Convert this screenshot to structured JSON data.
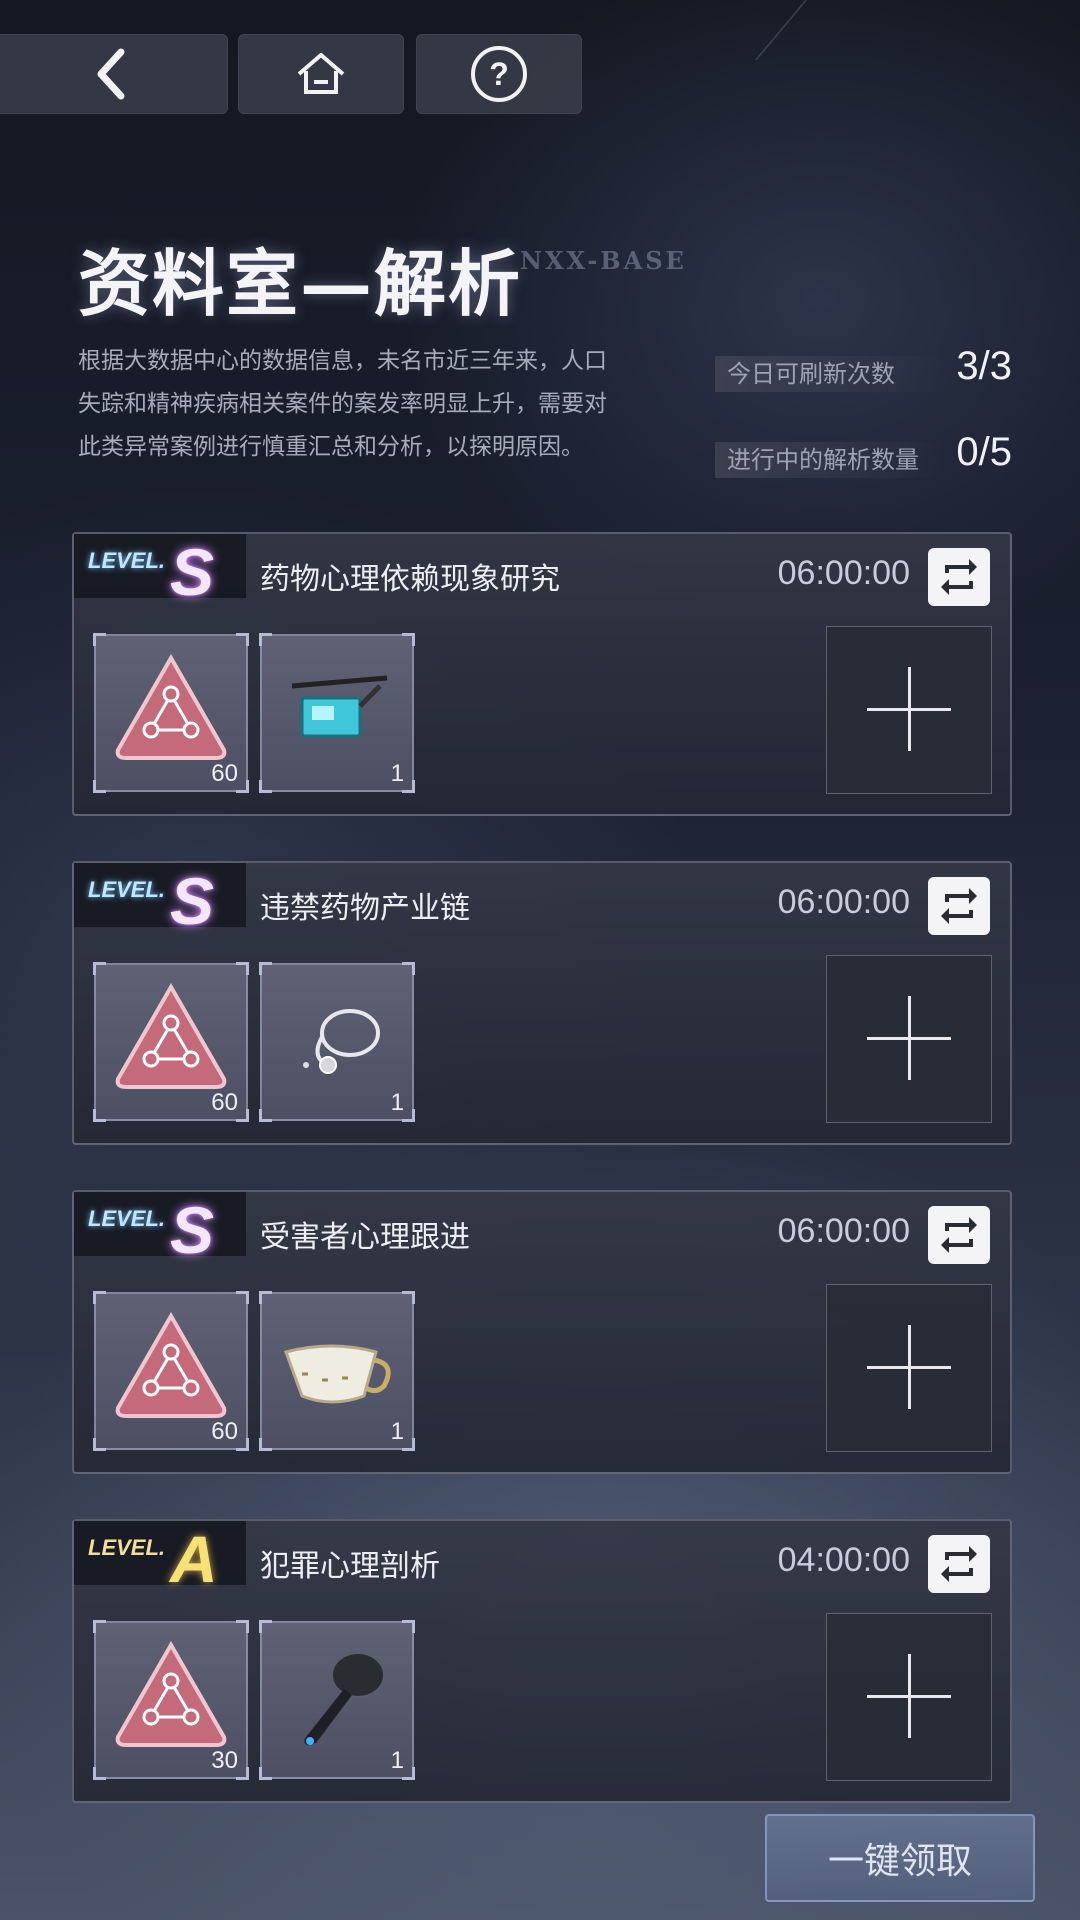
{
  "nav": {
    "back_icon": "chevron-left-icon",
    "home_icon": "home-icon",
    "help_icon": "question-circle-icon"
  },
  "header": {
    "title": "资料室—解析",
    "tag": "NXX-BASE",
    "description_lines": [
      "根据大数据中心的数据信息，未名市近三年来，人口",
      "失踪和精神疾病相关案件的案发率明显上升，需要对",
      "此类异常案例进行慎重汇总和分析，以探明原因。"
    ]
  },
  "stats": {
    "refresh_label": "今日可刷新次数",
    "refresh_value": "3/3",
    "progress_label": "进行中的解析数量",
    "progress_value": "0/5"
  },
  "tasks": [
    {
      "level_word": "LEVEL.",
      "level": "S",
      "title": "药物心理依赖现象研究",
      "time": "06:00:00",
      "items": [
        {
          "icon": "pink-triangle-emblem-icon",
          "qty": "60"
        },
        {
          "icon": "cyber-glasses-icon",
          "qty": "1"
        }
      ]
    },
    {
      "level_word": "LEVEL.",
      "level": "S",
      "title": "违禁药物产业链",
      "time": "06:00:00",
      "items": [
        {
          "icon": "pink-triangle-emblem-icon",
          "qty": "60"
        },
        {
          "icon": "stethoscope-icon",
          "qty": "1"
        }
      ]
    },
    {
      "level_word": "LEVEL.",
      "level": "S",
      "title": "受害者心理跟进",
      "time": "06:00:00",
      "items": [
        {
          "icon": "pink-triangle-emblem-icon",
          "qty": "60"
        },
        {
          "icon": "teacup-icon",
          "qty": "1"
        }
      ]
    },
    {
      "level_word": "LEVEL.",
      "level": "A",
      "title": "犯罪心理剖析",
      "time": "04:00:00",
      "items": [
        {
          "icon": "pink-triangle-emblem-icon",
          "qty": "30"
        },
        {
          "icon": "earbud-icon",
          "qty": "1"
        }
      ]
    }
  ],
  "claim_all_label": "一键领取"
}
